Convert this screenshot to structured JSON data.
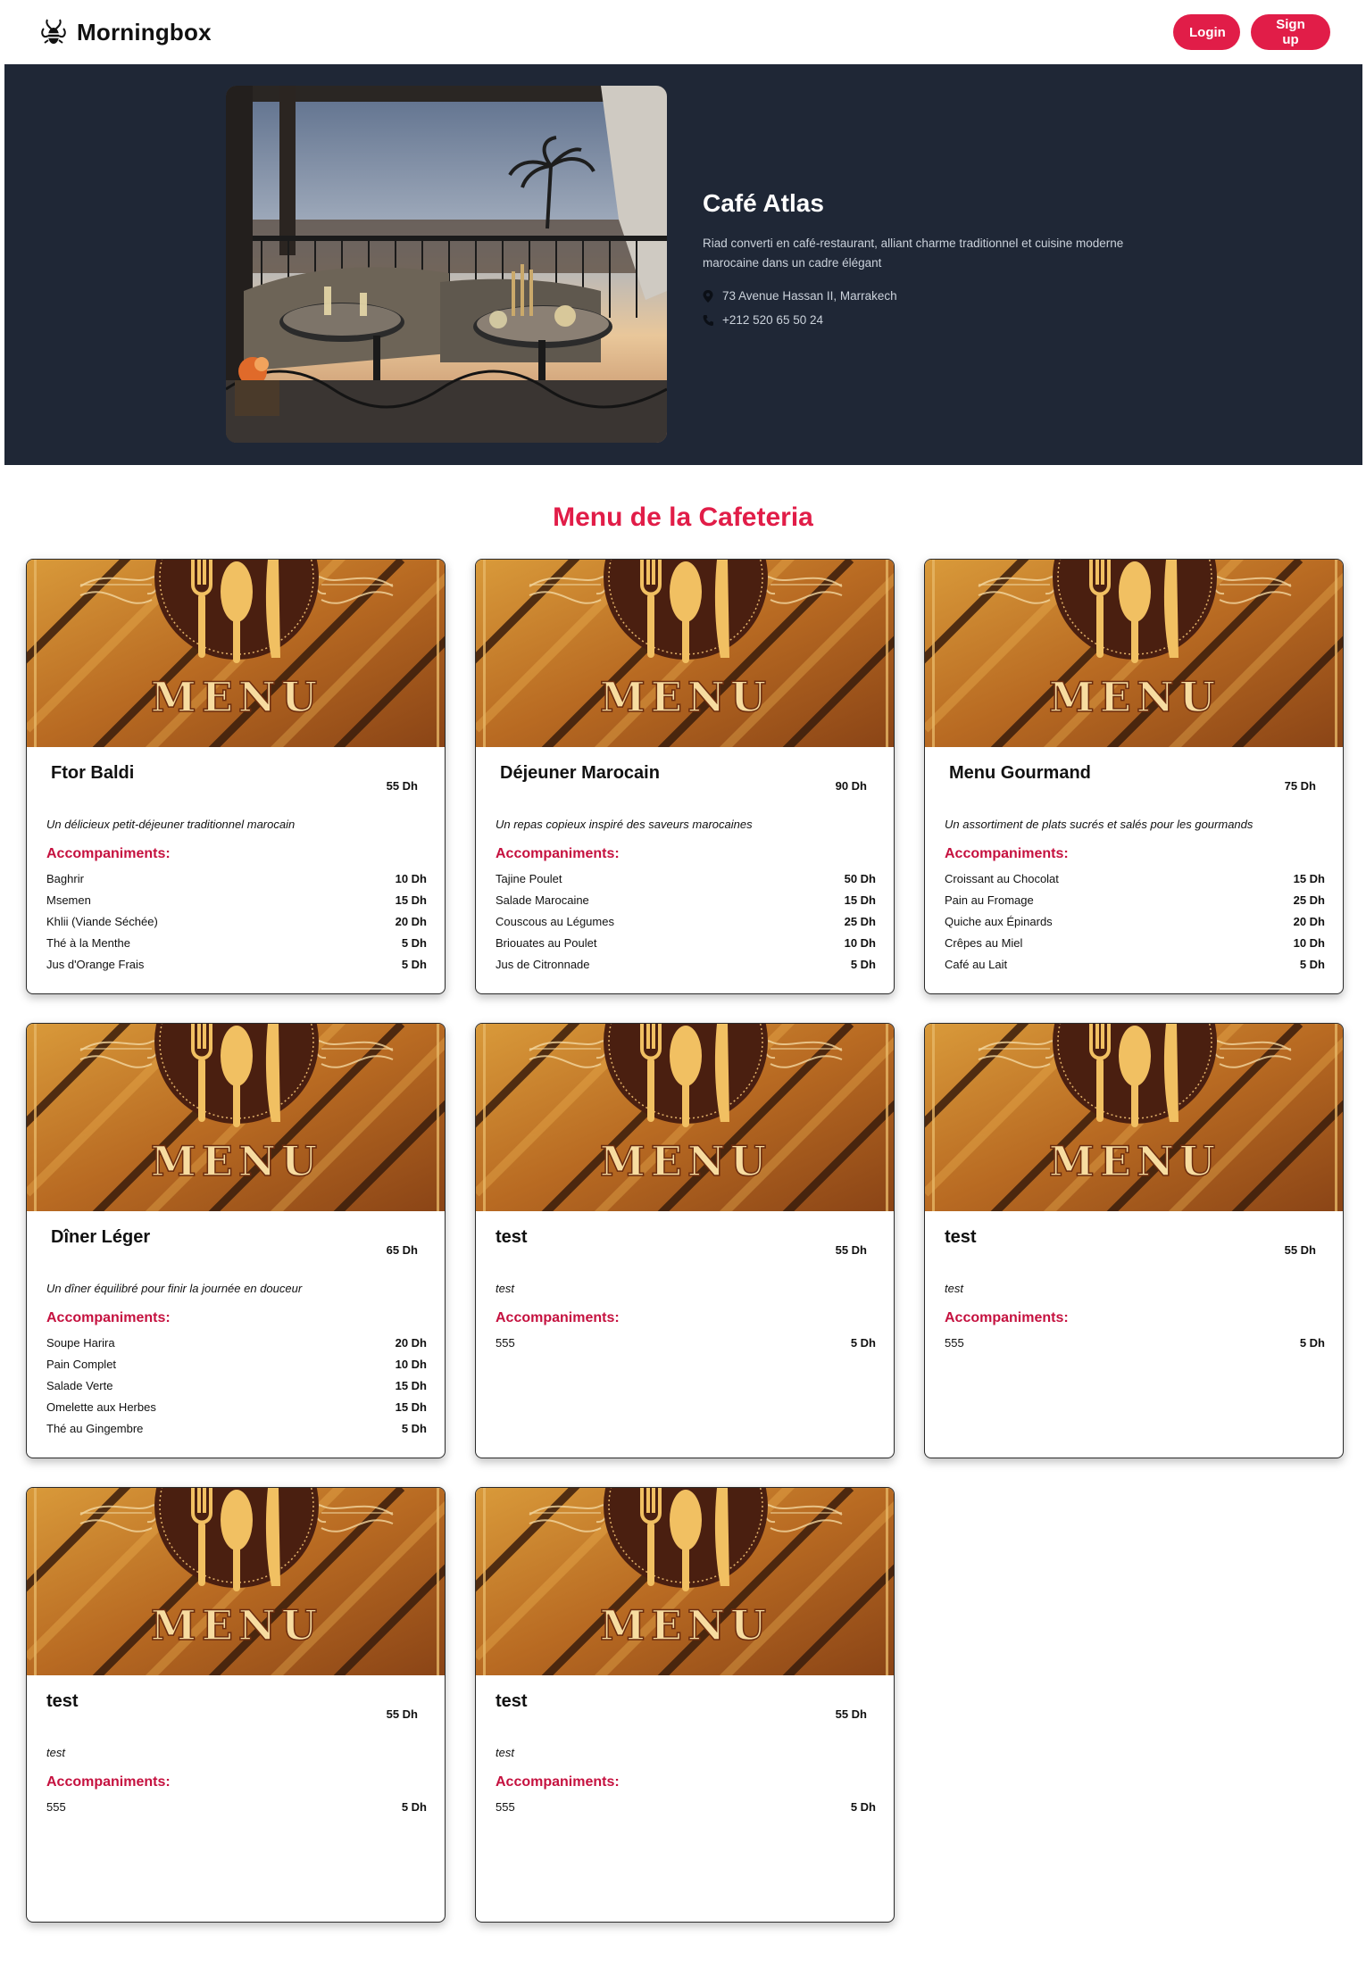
{
  "nav": {
    "brand": "Morningbox",
    "login": "Login",
    "signup": "Sign up"
  },
  "hero": {
    "title": "Café Atlas",
    "description": "Riad converti en café-restaurant, alliant charme traditionnel et cuisine moderne marocaine dans un cadre élégant",
    "address": "73 Avenue Hassan II, Marrakech",
    "phone": "+212 520 65 50 24"
  },
  "section_title": "Menu de la Cafeteria",
  "image_text": "MENU",
  "accompaniments_label": "Accompaniments:",
  "cards": [
    {
      "title": "Ftor Baldi",
      "price": "55 Dh",
      "description": "Un délicieux petit-déjeuner traditionnel marocain",
      "items": [
        {
          "name": "Baghrir",
          "price": "10 Dh"
        },
        {
          "name": "Msemen",
          "price": "15 Dh"
        },
        {
          "name": "Khlii (Viande Séchée)",
          "price": "20 Dh"
        },
        {
          "name": "Thé à la Menthe",
          "price": "5 Dh"
        },
        {
          "name": "Jus d'Orange Frais",
          "price": "5 Dh"
        }
      ]
    },
    {
      "title": "Déjeuner Marocain",
      "price": "90 Dh",
      "description": "Un repas copieux inspiré des saveurs marocaines",
      "items": [
        {
          "name": "Tajine Poulet",
          "price": "50 Dh"
        },
        {
          "name": "Salade Marocaine",
          "price": "15 Dh"
        },
        {
          "name": "Couscous au Légumes",
          "price": "25 Dh"
        },
        {
          "name": "Briouates au Poulet",
          "price": "10 Dh"
        },
        {
          "name": "Jus de Citronnade",
          "price": "5 Dh"
        }
      ]
    },
    {
      "title": "Menu Gourmand",
      "price": "75 Dh",
      "description": "Un assortiment de plats sucrés et salés pour les gourmands",
      "items": [
        {
          "name": "Croissant au Chocolat",
          "price": "15 Dh"
        },
        {
          "name": "Pain au Fromage",
          "price": "25 Dh"
        },
        {
          "name": "Quiche aux Épinards",
          "price": "20 Dh"
        },
        {
          "name": "Crêpes au Miel",
          "price": "10 Dh"
        },
        {
          "name": "Café au Lait",
          "price": "5 Dh"
        }
      ]
    },
    {
      "title": "Dîner Léger",
      "price": "65 Dh",
      "description": "Un dîner équilibré pour finir la journée en douceur",
      "items": [
        {
          "name": "Soupe Harira",
          "price": "20 Dh"
        },
        {
          "name": "Pain Complet",
          "price": "10 Dh"
        },
        {
          "name": "Salade Verte",
          "price": "15 Dh"
        },
        {
          "name": "Omelette aux Herbes",
          "price": "15 Dh"
        },
        {
          "name": "Thé au Gingembre",
          "price": "5 Dh"
        }
      ]
    },
    {
      "title": "test",
      "price": "55 Dh",
      "description": "test",
      "items": [
        {
          "name": "555",
          "price": "5 Dh"
        }
      ]
    },
    {
      "title": "test",
      "price": "55 Dh",
      "description": "test",
      "items": [
        {
          "name": "555",
          "price": "5 Dh"
        }
      ]
    },
    {
      "title": "test",
      "price": "55 Dh",
      "description": "test",
      "items": [
        {
          "name": "555",
          "price": "5 Dh"
        }
      ]
    },
    {
      "title": "test",
      "price": "55 Dh",
      "description": "test",
      "items": [
        {
          "name": "555",
          "price": "5 Dh"
        }
      ]
    }
  ],
  "colors": {
    "accent": "#e11d48",
    "hero_bg": "#1f2736",
    "wood": "#b5651d"
  }
}
